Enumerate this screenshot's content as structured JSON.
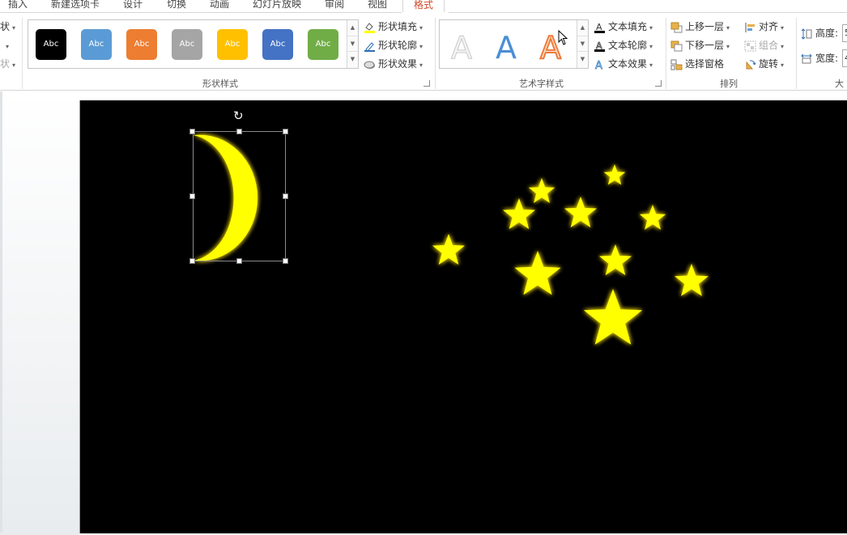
{
  "tabs": {
    "items": [
      "插入",
      "新建选项卡",
      "设计",
      "切换",
      "动画",
      "幻灯片放映",
      "审阅",
      "视图",
      "格式"
    ],
    "active_index": 8
  },
  "ribbon": {
    "left_partial": {
      "row1": "状",
      "row2": "",
      "row3": "状"
    },
    "shape_styles": {
      "label": "形状样式",
      "swatches": [
        {
          "text": "Abc",
          "color": "#000000"
        },
        {
          "text": "Abc",
          "color": "#5b9bd5"
        },
        {
          "text": "Abc",
          "color": "#ed7d31"
        },
        {
          "text": "Abc",
          "color": "#a5a5a5"
        },
        {
          "text": "Abc",
          "color": "#ffc000"
        },
        {
          "text": "Abc",
          "color": "#4472c4"
        },
        {
          "text": "Abc",
          "color": "#70ad47"
        }
      ],
      "fill": "形状填充",
      "outline": "形状轮廓",
      "effects": "形状效果"
    },
    "wordart": {
      "label": "艺术字样式",
      "samples": [
        "A",
        "A",
        "A"
      ],
      "text_fill": "文本填充",
      "text_outline": "文本轮廓",
      "text_effects": "文本效果"
    },
    "arrange": {
      "label": "排列",
      "bring_forward": "上移一层",
      "send_backward": "下移一层",
      "selection_pane": "选择窗格",
      "align": "对齐",
      "group": "组合",
      "rotate": "旋转"
    },
    "size": {
      "label": "大",
      "height": "高度:",
      "width": "宽度:",
      "height_value": "5",
      "width_value": "4"
    }
  },
  "colors": {
    "accent": "#d24726",
    "slide_bg": "#000000",
    "moon": "#ffff00",
    "star": "#ffff00",
    "glow": "#c8b400"
  },
  "slide": {
    "moon_selected": true,
    "star_count": 11
  }
}
